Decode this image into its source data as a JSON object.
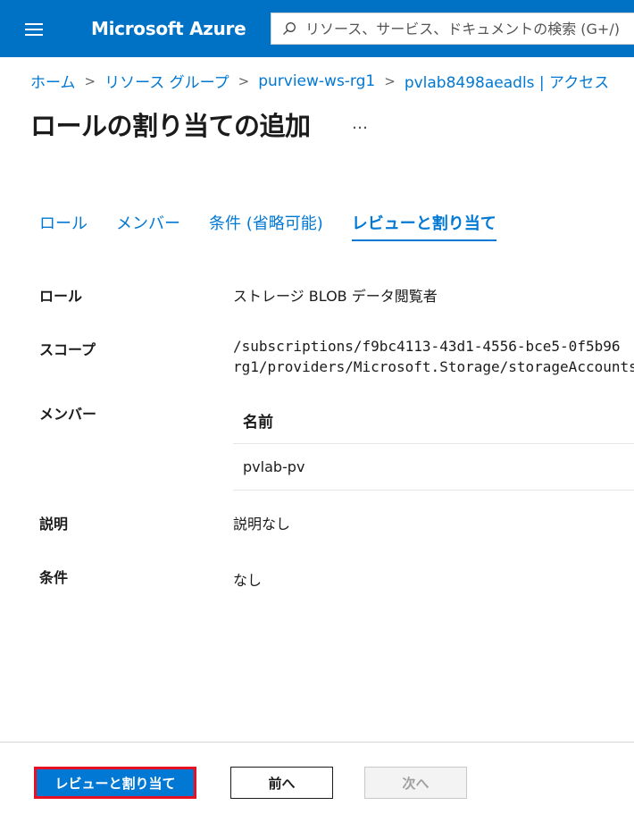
{
  "header": {
    "brand": "Microsoft Azure",
    "search_placeholder": "リソース、サービス、ドキュメントの検索 (G+/)"
  },
  "breadcrumb": {
    "items": [
      "ホーム",
      "リソース グループ",
      "purview-ws-rg1",
      "pvlab8498aeadls | アクセス"
    ]
  },
  "page": {
    "title": "ロールの割り当ての追加",
    "more": "…"
  },
  "tabs": [
    {
      "label": "ロール",
      "active": false
    },
    {
      "label": "メンバー",
      "active": false
    },
    {
      "label": "条件 (省略可能)",
      "active": false
    },
    {
      "label": "レビューと割り当て",
      "active": true
    }
  ],
  "details": {
    "role_label": "ロール",
    "role_value": "ストレージ BLOB データ閲覧者",
    "scope_label": "スコープ",
    "scope_line1": "/subscriptions/f9bc4113-43d1-4556-bce5-0f5b96",
    "scope_line2": "rg1/providers/Microsoft.Storage/storageAccounts",
    "members_label": "メンバー",
    "members_table": {
      "column_name": "名前",
      "rows": [
        "pvlab-pv"
      ]
    },
    "description_label": "説明",
    "description_value": "説明なし",
    "conditions_label": "条件",
    "conditions_value": "なし"
  },
  "footer": {
    "review_assign_label": "レビューと割り当て",
    "prev_label": "前へ",
    "next_label": "次へ"
  },
  "colors": {
    "topbar": "#0072c6",
    "accent": "#0078d4",
    "highlight_border": "#e81123"
  }
}
